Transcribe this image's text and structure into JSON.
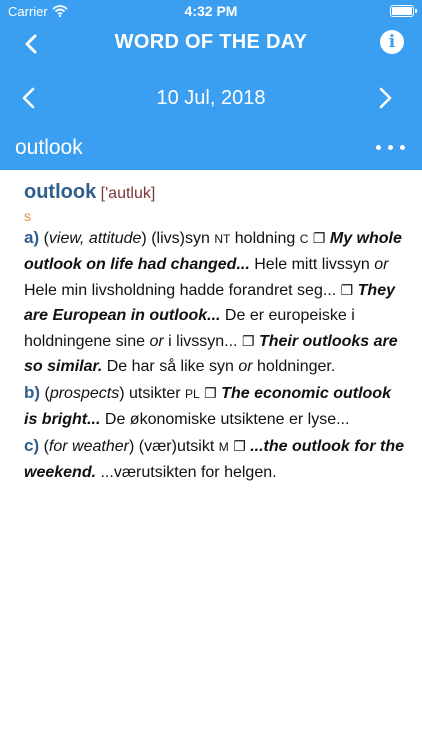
{
  "status": {
    "carrier": "Carrier",
    "time": "4:32 PM"
  },
  "nav": {
    "title": "WORD OF THE DAY",
    "info_label": "i"
  },
  "datebar": {
    "date": "10 Jul, 2018"
  },
  "wordbar": {
    "word": "outlook"
  },
  "entry": {
    "headword": "outlook",
    "pron_open": "[",
    "pronunciation": "'autluk",
    "pron_close": "]",
    "pos": "s",
    "box": "❐",
    "a_label": "a)",
    "a_gloss": "view, attitude",
    "a_trans1": "(livs)syn",
    "a_gender1": "NT",
    "a_trans2": "holdning",
    "a_gender2": "C",
    "a_ex1": "My whole outlook on life had changed...",
    "a_ex1_trans_a": "Hele mitt livssyn",
    "or": "or",
    "a_ex1_trans_b": "Hele min livsholdning hadde forandret seg...",
    "a_ex2": "They are European in outlook...",
    "a_ex2_trans_a": "De er europeiske i holdningene sine",
    "a_ex2_trans_b": "i livssyn...",
    "a_ex3": "Their outlooks are so similar.",
    "a_ex3_trans_a": "De har så like syn",
    "a_ex3_trans_b": "holdninger.",
    "b_label": "b)",
    "b_gloss": "prospects",
    "b_trans": "utsikter",
    "b_gender": "PL",
    "b_ex": "The economic outlook is bright...",
    "b_ex_trans": "De økonomiske utsiktene er lyse...",
    "c_label": "c)",
    "c_gloss": "for weather",
    "c_trans": "(vær)utsikt",
    "c_gender": "M",
    "c_ex": "...the outlook for the weekend.",
    "c_ex_trans": "...værutsikten for helgen."
  }
}
